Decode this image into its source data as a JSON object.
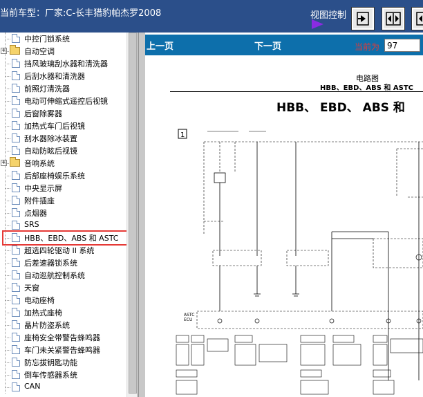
{
  "header": {
    "car_label": "当前车型：厂家:C-长丰猎豹帕杰罗2008",
    "view_control_label": "视图控制",
    "buttons": [
      {
        "name": "next-page-icon"
      },
      {
        "name": "fit-width-icon"
      },
      {
        "name": "fit-page-icon"
      }
    ]
  },
  "sidebar": {
    "items": [
      {
        "label": "中控门锁系统",
        "type": "doc"
      },
      {
        "label": "自动空调",
        "type": "folder"
      },
      {
        "label": "挡风玻璃刮水器和清洗器",
        "type": "doc"
      },
      {
        "label": "后刮水器和清洗器",
        "type": "doc"
      },
      {
        "label": "前照灯清洗器",
        "type": "doc"
      },
      {
        "label": "电动可伸缩式遥控后视镜",
        "type": "doc"
      },
      {
        "label": "后窗除雾器",
        "type": "doc"
      },
      {
        "label": "加热式车门后视镜",
        "type": "doc"
      },
      {
        "label": "刮水器除冰装置",
        "type": "doc"
      },
      {
        "label": "自动防眩后视镜",
        "type": "doc"
      },
      {
        "label": "音响系统",
        "type": "folder"
      },
      {
        "label": "后部座椅娱乐系统",
        "type": "doc"
      },
      {
        "label": "中央显示屏",
        "type": "doc"
      },
      {
        "label": "附件插座",
        "type": "doc"
      },
      {
        "label": "点烟器",
        "type": "doc"
      },
      {
        "label": "SRS",
        "type": "doc"
      },
      {
        "label": "HBB、EBD、ABS 和 ASTC",
        "type": "doc"
      },
      {
        "label": "超选四轮驱动 II 系统",
        "type": "doc"
      },
      {
        "label": "后差速器锁系统",
        "type": "doc"
      },
      {
        "label": "自动巡航控制系统",
        "type": "doc"
      },
      {
        "label": "天窗",
        "type": "doc"
      },
      {
        "label": "电动座椅",
        "type": "doc"
      },
      {
        "label": "加热式座椅",
        "type": "doc"
      },
      {
        "label": "晶片防盗系统",
        "type": "doc"
      },
      {
        "label": "座椅安全带警告蜂鸣器",
        "type": "doc"
      },
      {
        "label": "车门未关紧警告蜂鸣器",
        "type": "doc"
      },
      {
        "label": "防忘拔钥匙功能",
        "type": "doc"
      },
      {
        "label": "倒车传感器系统",
        "type": "doc"
      },
      {
        "label": "CAN",
        "type": "doc"
      }
    ],
    "selected_index": 16
  },
  "nav": {
    "prev_label": "上一页",
    "next_label": "下一页",
    "current_label": "当前为",
    "page_value": "97"
  },
  "document": {
    "title": "电路图",
    "subtitle": "HBB、EBD、ABS 和 ASTC",
    "heading": "HBB、 EBD、 ABS 和",
    "figure_number": "1",
    "ecu_label": "ASTC\nECU"
  },
  "colors": {
    "header_bg": "#2b4f8a",
    "nav_bg": "#0d6fab",
    "highlight": "#e53935",
    "view_triangle": "#8a2be2"
  }
}
